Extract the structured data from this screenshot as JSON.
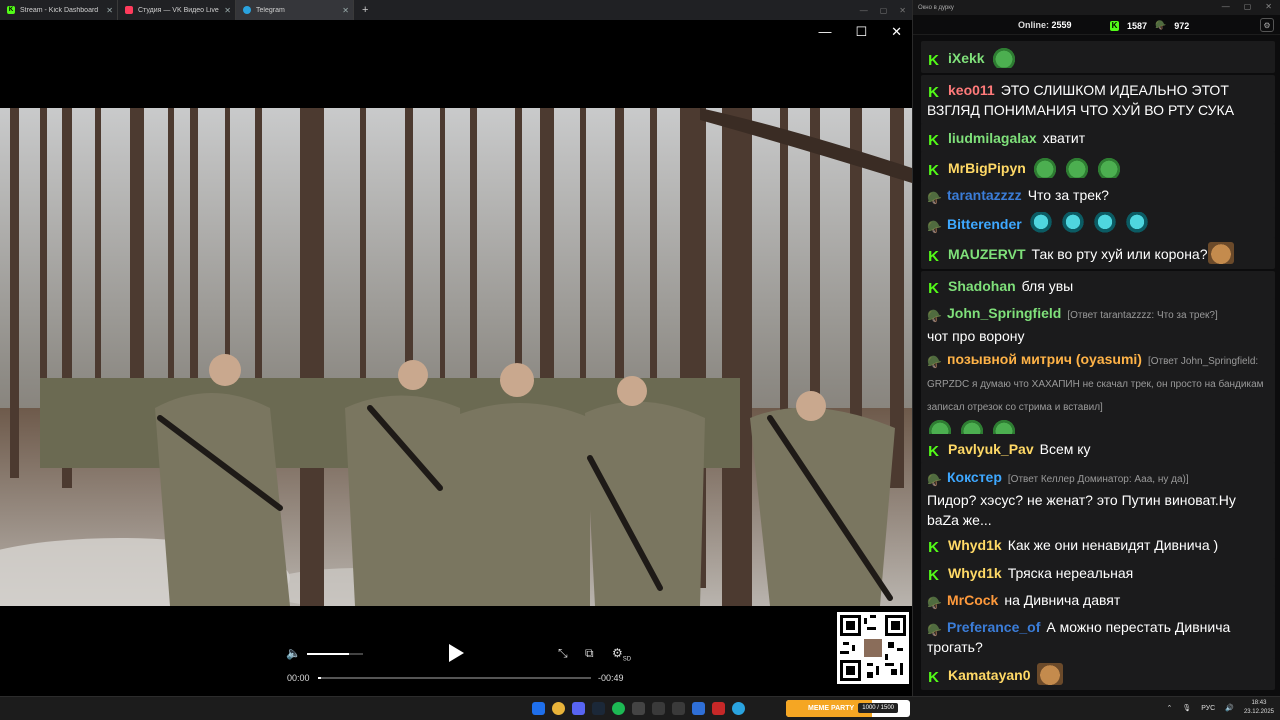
{
  "browser": {
    "tabs": [
      {
        "label": "Stream - Kick Dashboard",
        "icon": "kick-icon",
        "color": "#53fc18",
        "active": false
      },
      {
        "label": "Студия — VK Видео Live",
        "icon": "vk-video-icon",
        "color": "#ff3b5c",
        "active": false
      },
      {
        "label": "Telegram",
        "icon": "telegram-icon",
        "color": "#2aa3df",
        "active": true
      }
    ],
    "new_tab": "+"
  },
  "player": {
    "time_current": "00:00",
    "time_remaining": "-00:49",
    "volume_level": 0.75,
    "progress": 0.01,
    "quality_badge": "SD"
  },
  "chat": {
    "window_title": "Окно в дурку",
    "online_label": "Online:",
    "online_count": "2559",
    "kick_count": "1587",
    "vk_count": "972",
    "messages": [
      {
        "user": "iXekk",
        "color": "#7fe07a",
        "text": "",
        "badge": "kick"
      },
      {
        "user": "keo011",
        "color": "#ff7a7a",
        "text": "ЭТО СЛИШКОМ ИДЕАЛЬНО ЭТОТ ВЗГЛЯД ПОНИМАНИЯ ЧТО ХУЙ ВО РТУ СУКА",
        "badge": "kick"
      },
      {
        "user": "liudmilagalax",
        "color": "#7fe07a",
        "text": "хватит",
        "badge": "kick"
      },
      {
        "user": "MrBigPipyn",
        "color": "#ffd966",
        "text": "",
        "badge": "kick"
      },
      {
        "user": "tarantazzzz",
        "color": "#3b7dd8",
        "text": "Что за трек?",
        "badge": "vk"
      },
      {
        "user": "Bitterender",
        "color": "#3ea8ff",
        "text": "",
        "badge": "vk"
      },
      {
        "user": "MAUZERVT",
        "color": "#7fe07a",
        "text": "Так во рту хуй или корона?",
        "badge": "kick"
      },
      {
        "user": "Shadohan",
        "color": "#7fe07a",
        "text": "бля увы",
        "badge": "kick"
      },
      {
        "user": "John_Springfield",
        "color": "#7fe07a",
        "text": "чот про ворону",
        "reply": "[Ответ tarantazzzz: Что за трек?]",
        "badge": "vk"
      },
      {
        "user": "позывной митрич (oyasumi)",
        "color": "#ffb347",
        "text": "",
        "reply": "[Ответ John_Springfield: GRPZDC я думаю что ХАХАПИН не скачал трек, он просто на бандикам записал отрезок со стрима и вставил]",
        "badge": "vk"
      },
      {
        "user": "Pavlyuk_Pav",
        "color": "#ffd966",
        "text": "Всем ку",
        "badge": "kick"
      },
      {
        "user": "Кокстер",
        "color": "#3ea8ff",
        "text": "Пидор? хэсус? не женат? это Путин виноват.Ну baZa же...",
        "reply": "[Ответ Келлер Доминатор: Ааа, ну да)]",
        "badge": "vk"
      },
      {
        "user": "Whyd1k",
        "color": "#ffd966",
        "text": "Как же они ненавидят Дивнича )",
        "badge": "kick"
      },
      {
        "user": "Whyd1k",
        "color": "#ffd966",
        "text": "Тряска нереальная",
        "badge": "kick"
      },
      {
        "user": "MrCock",
        "color": "#ff9a3c",
        "text": "на Дивнича давят",
        "badge": "vk"
      },
      {
        "user": "Preferance_of",
        "color": "#3b7dd8",
        "text": "А можно перестать Дивнича трогать?",
        "badge": "vk"
      },
      {
        "user": "Kamatayan0",
        "color": "#ffd966",
        "text": "",
        "badge": "kick"
      }
    ]
  },
  "taskbar": {
    "banner_label": "MEME PARTY",
    "banner_count": "1000 / 1500",
    "lang": "РУС",
    "time": "18:43",
    "date": "23.12.2025"
  }
}
